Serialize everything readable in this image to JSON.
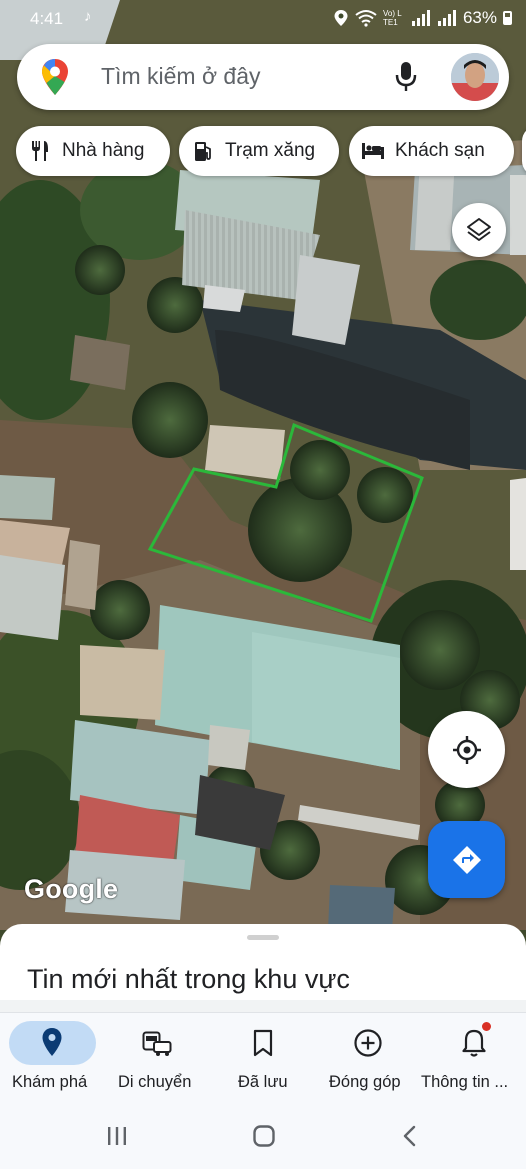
{
  "status_bar": {
    "time": "4:41",
    "battery_percent": "63%",
    "network_label": "Vo) LTE1"
  },
  "search": {
    "placeholder": "Tìm kiếm ở đây"
  },
  "chips": [
    {
      "label": "Nhà hàng",
      "icon": "restaurant-icon"
    },
    {
      "label": "Trạm xăng",
      "icon": "gas-station-icon"
    },
    {
      "label": "Khách sạn",
      "icon": "hotel-icon"
    }
  ],
  "map": {
    "attribution": "Google",
    "parcel_outline_color": "#2bb83a"
  },
  "bottom_sheet": {
    "title": "Tin mới nhất trong khu vực"
  },
  "bottom_nav": {
    "items": [
      {
        "label": "Khám phá",
        "icon": "explore-pin-icon",
        "selected": true
      },
      {
        "label": "Di chuyển",
        "icon": "commute-icon"
      },
      {
        "label": "Đã lưu",
        "icon": "bookmark-icon"
      },
      {
        "label": "Đóng góp",
        "icon": "add-circle-icon"
      },
      {
        "label": "Thông tin ...",
        "icon": "bell-icon",
        "has_badge": true
      }
    ]
  },
  "colors": {
    "accent_blue": "#1a73e8",
    "selected_pill": "#c2dbf5",
    "badge_red": "#d93025"
  }
}
